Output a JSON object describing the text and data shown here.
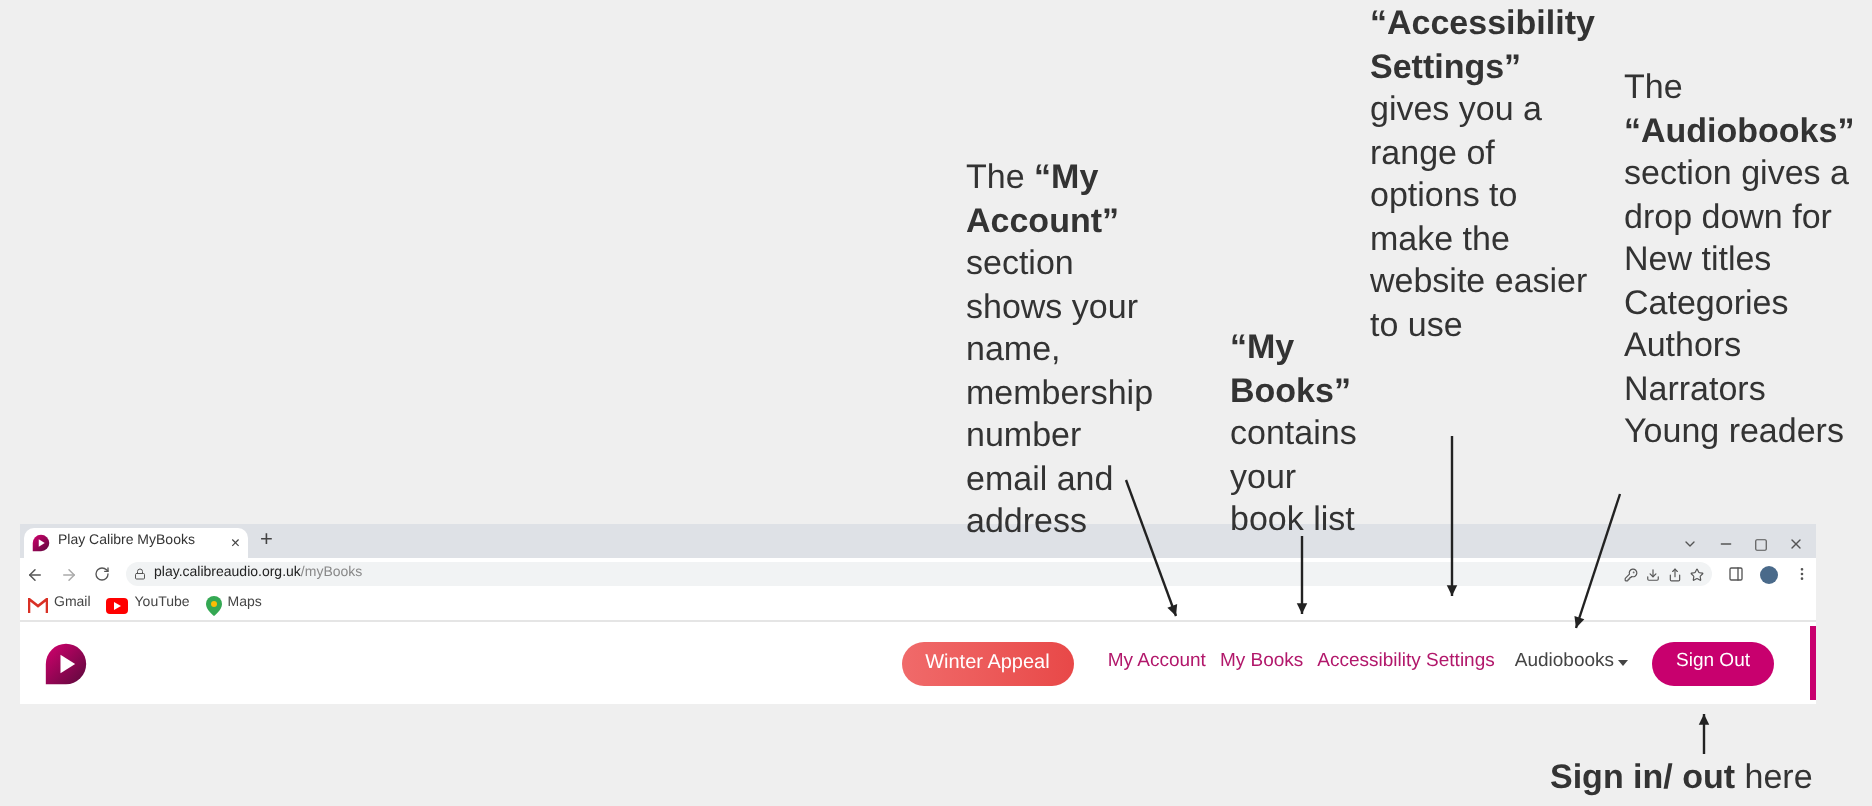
{
  "annotations": [
    {
      "kind": "my-account",
      "lines": [
        "The **“My**",
        "**Account”**",
        "section",
        "shows your",
        "name,",
        "membership",
        "number",
        "email and",
        "address"
      ]
    },
    {
      "kind": "my-books",
      "lines": [
        "**“My**",
        "**Books”**",
        "contains",
        "your",
        "book list"
      ]
    },
    {
      "kind": "accessibility",
      "lines": [
        "**“Accessibility**",
        "**Settings”**",
        "gives you a",
        "range of",
        "options to",
        "make the",
        "website easier",
        "to use"
      ]
    },
    {
      "kind": "audiobooks",
      "lines": [
        "The",
        "**“Audiobooks”**",
        "section gives a",
        "drop down for",
        "New titles",
        "Categories",
        "Authors",
        "Narrators",
        "Young readers"
      ]
    },
    {
      "kind": "sign-out",
      "lines": [
        "**Sign in/ out** here"
      ]
    }
  ],
  "browser": {
    "tab": {
      "title": "Play Calibre MyBooks",
      "close": "×",
      "selected": true
    },
    "new_tab": "+",
    "url_host": "play.calibreaudio.org.uk",
    "url_path": "/myBooks",
    "bookmarks": [
      {
        "kind": "gmail",
        "label": "Gmail"
      },
      {
        "kind": "youtube",
        "label": "YouTube"
      },
      {
        "kind": "maps",
        "label": "Maps"
      }
    ]
  },
  "site": {
    "appeal": "Winter Appeal",
    "nav": [
      {
        "label": "My Account",
        "kind": "link"
      },
      {
        "label": "My Books",
        "kind": "link"
      },
      {
        "label": "Accessibility Settings",
        "kind": "link"
      },
      {
        "label": "Audiobooks",
        "kind": "dropdown"
      }
    ],
    "sign_out": "Sign Out"
  }
}
